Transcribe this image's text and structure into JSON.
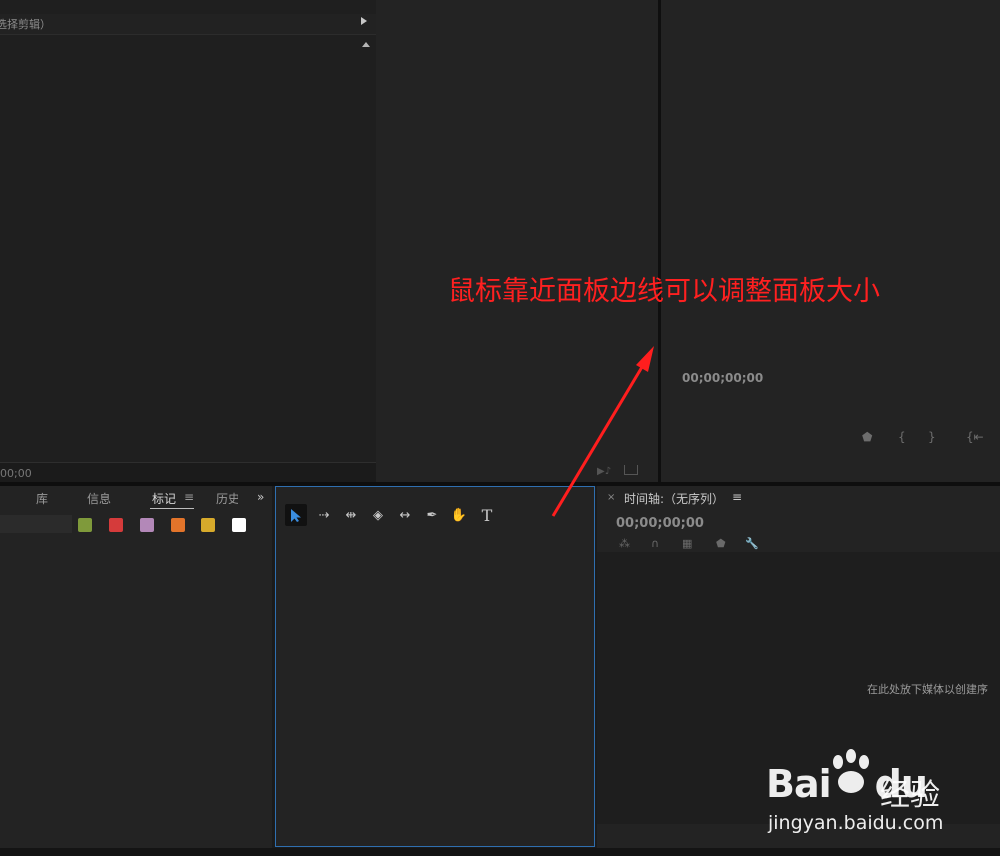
{
  "source_panel": {
    "header_text": "选择剪辑）",
    "timecode": "00;00"
  },
  "program_monitor": {
    "timecode": "00;00;00;00",
    "controls": [
      "mark-in-icon",
      "bracket-in-icon",
      "bracket-out-icon",
      "go-to-in-icon"
    ]
  },
  "markers_panel": {
    "tabs": [
      {
        "label": "库"
      },
      {
        "label": "信息"
      },
      {
        "label": "标记"
      },
      {
        "label": "历史"
      }
    ],
    "active_tab_menu": "≡",
    "overflow": "»",
    "swatch_colors": [
      "#7f9a3b",
      "#d53b3b",
      "#b388b8",
      "#e3742a",
      "#d7aa2b",
      "#ffffff"
    ]
  },
  "tools_panel": {
    "tools": [
      {
        "name": "selection-tool",
        "glyph": "▲"
      },
      {
        "name": "track-select-tool",
        "glyph": "⇢"
      },
      {
        "name": "ripple-edit-tool",
        "glyph": "⇹"
      },
      {
        "name": "razor-tool",
        "glyph": "◈"
      },
      {
        "name": "slip-tool",
        "glyph": "↔"
      },
      {
        "name": "pen-tool",
        "glyph": "✒"
      },
      {
        "name": "hand-tool",
        "glyph": "✋"
      },
      {
        "name": "type-tool",
        "glyph": "T"
      }
    ]
  },
  "timeline_panel": {
    "close": "×",
    "title": "时间轴:（无序列）",
    "menu": "≡",
    "timecode": "00;00;00;00",
    "drop_hint": "在此处放下媒体以创建序"
  },
  "annotation": {
    "text": "鼠标靠近面板边线可以调整面板大小",
    "color": "#ff2020"
  },
  "watermark": {
    "brand_a": "Bai",
    "brand_b": "du",
    "product": "经验",
    "url": "jingyan.baidu.com"
  }
}
